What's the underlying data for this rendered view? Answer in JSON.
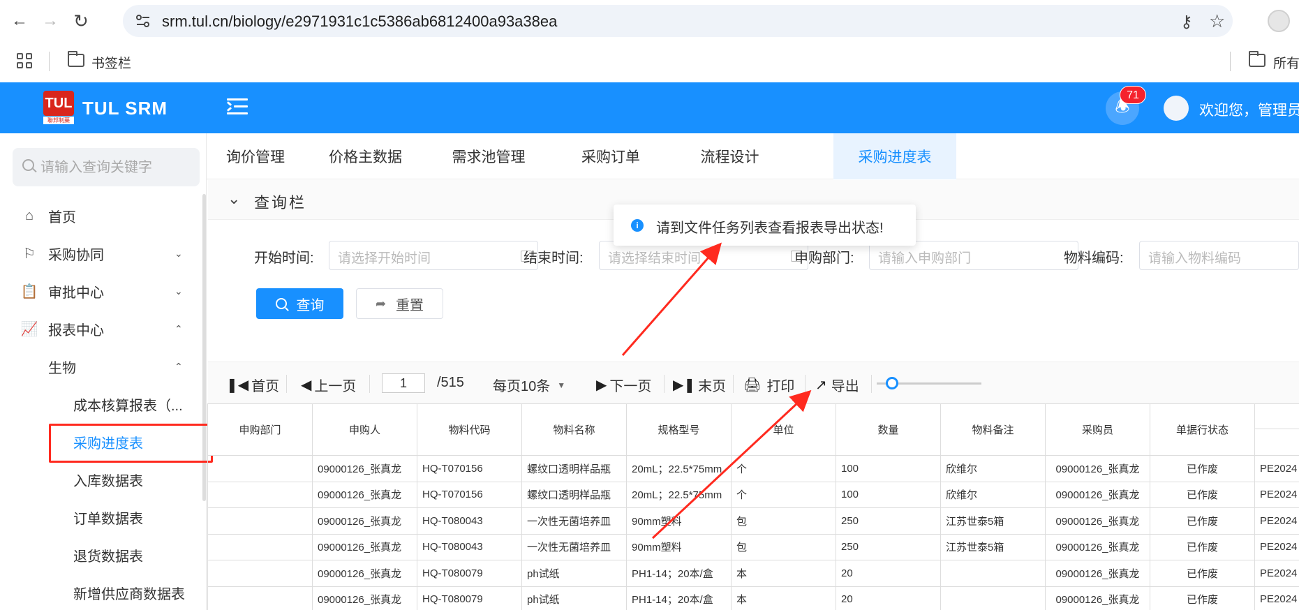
{
  "browser": {
    "url": "srm.tul.cn/biology/e2971931c1c5386ab6812400a93a38ea",
    "bookmarks_label": "书签栏",
    "all_bookmarks_label": "所有"
  },
  "header": {
    "app_title": "TUL SRM",
    "logo_text": "TUL",
    "logo_subtext": "聯邦制藥",
    "notification_count": "71",
    "welcome": "欢迎您，管理员"
  },
  "sidebar": {
    "search_placeholder": "请输入查询关键字",
    "items": [
      {
        "label": "首页",
        "icon": "home-icon"
      },
      {
        "label": "采购协同",
        "icon": "flag-icon",
        "expanded": false
      },
      {
        "label": "审批中心",
        "icon": "approval-icon",
        "expanded": false
      },
      {
        "label": "报表中心",
        "icon": "chart-icon",
        "expanded": true
      },
      {
        "label": "生物",
        "expanded": true
      },
      {
        "label": "成本核算报表（..."
      },
      {
        "label": "采购进度表",
        "active": true
      },
      {
        "label": "入库数据表"
      },
      {
        "label": "订单数据表"
      },
      {
        "label": "退货数据表"
      },
      {
        "label": "新增供应商数据表"
      }
    ]
  },
  "tabs": [
    {
      "label": "询价管理"
    },
    {
      "label": "价格主数据"
    },
    {
      "label": "需求池管理"
    },
    {
      "label": "采购订单"
    },
    {
      "label": "流程设计"
    },
    {
      "label": "采购进度表",
      "active": true
    }
  ],
  "query": {
    "title": "查询栏",
    "fields": [
      {
        "label": "开始时间:",
        "placeholder": "请选择开始时间"
      },
      {
        "label": "结束时间:",
        "placeholder": "请选择结束时间"
      },
      {
        "label": "申购部门:",
        "placeholder": "请输入申购部门"
      },
      {
        "label": "物料编码:",
        "placeholder": "请输入物料编码"
      }
    ],
    "query_button": "查询",
    "reset_button": "重置"
  },
  "toast": {
    "message": "请到文件任务列表查看报表导出状态!"
  },
  "pager": {
    "first": "首页",
    "prev": "上一页",
    "current_page": "1",
    "total_pages": "/515",
    "page_size": "每页10条",
    "next": "下一页",
    "last": "末页",
    "print": "打印",
    "export": "导出"
  },
  "table": {
    "headers": [
      "申购部门",
      "申购人",
      "物料代码",
      "物料名称",
      "规格型号",
      "单位",
      "数量",
      "物料备注",
      "采购员",
      "单据行状态",
      ""
    ],
    "rows": [
      [
        "",
        "09000126_张真龙",
        "HQ-T070156",
        "螺纹口透明样品瓶",
        "20mL；22.5*75mm",
        "个",
        "100",
        "欣维尔",
        "09000126_张真龙",
        "已作废",
        "PE2024"
      ],
      [
        "",
        "09000126_张真龙",
        "HQ-T070156",
        "螺纹口透明样品瓶",
        "20mL；22.5*75mm",
        "个",
        "100",
        "欣维尔",
        "09000126_张真龙",
        "已作废",
        "PE2024"
      ],
      [
        "",
        "09000126_张真龙",
        "HQ-T080043",
        "一次性无菌培养皿",
        "90mm塑料",
        "包",
        "250",
        "江苏世泰5箱",
        "09000126_张真龙",
        "已作废",
        "PE2024"
      ],
      [
        "",
        "09000126_张真龙",
        "HQ-T080043",
        "一次性无菌培养皿",
        "90mm塑料",
        "包",
        "250",
        "江苏世泰5箱",
        "09000126_张真龙",
        "已作废",
        "PE2024"
      ],
      [
        "",
        "09000126_张真龙",
        "HQ-T080079",
        "ph试纸",
        "PH1-14；20本/盒",
        "本",
        "20",
        "",
        "09000126_张真龙",
        "已作废",
        "PE2024"
      ],
      [
        "",
        "09000126_张真龙",
        "HQ-T080079",
        "ph试纸",
        "PH1-14；20本/盒",
        "本",
        "20",
        "",
        "09000126_张真龙",
        "已作废",
        "PE2024"
      ]
    ]
  },
  "colors": {
    "brand_blue": "#1890ff",
    "annotation_red": "#ff2a1f",
    "badge_red": "#f5222d"
  }
}
